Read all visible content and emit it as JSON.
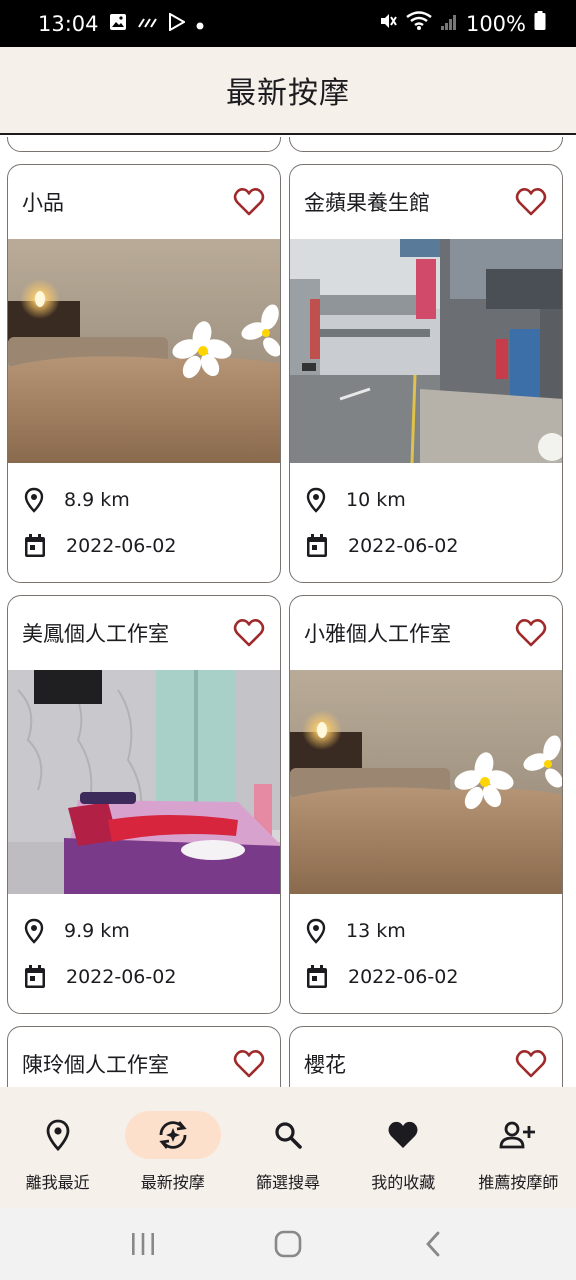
{
  "status_bar": {
    "time": "13:04",
    "battery": "100%"
  },
  "app_bar": {
    "title": "最新按摩"
  },
  "cards": [
    {
      "name": "小品",
      "distance": "8.9 km",
      "date": "2022-06-02",
      "favorited": false,
      "image": "spa-candle-flowers"
    },
    {
      "name": "金蘋果養生館",
      "distance": "10 km",
      "date": "2022-06-02",
      "favorited": false,
      "image": "street-view"
    },
    {
      "name": "美鳳個人工作室",
      "distance": "9.9 km",
      "date": "2022-06-02",
      "favorited": false,
      "image": "massage-room"
    },
    {
      "name": "小雅個人工作室",
      "distance": "13 km",
      "date": "2022-06-02",
      "favorited": false,
      "image": "spa-candle-flowers"
    },
    {
      "name": "陳玲個人工作室",
      "favorited": false
    },
    {
      "name": "櫻花",
      "favorited": false
    }
  ],
  "bottom_nav": {
    "items": [
      {
        "label": "離我最近",
        "icon": "location-pin-icon",
        "active": false
      },
      {
        "label": "最新按摩",
        "icon": "refresh-sparkle-icon",
        "active": true
      },
      {
        "label": "篩選搜尋",
        "icon": "search-icon",
        "active": false
      },
      {
        "label": "我的收藏",
        "icon": "heart-filled-icon",
        "active": false
      },
      {
        "label": "推薦按摩師",
        "icon": "person-add-icon",
        "active": false
      }
    ]
  },
  "colors": {
    "accent": "#9e2a2b",
    "surface": "#f6f0ea",
    "active_pill": "#fde0cc",
    "text": "#1c1b1f"
  }
}
